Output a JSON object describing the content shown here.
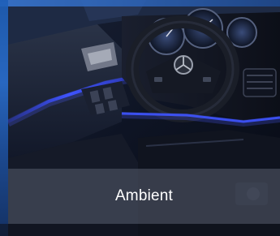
{
  "tile": {
    "caption": "Ambient",
    "accent_color": "#2e5bff",
    "caption_bg": "#464c5c"
  },
  "image": {
    "subject_icon": "car-interior-image"
  }
}
